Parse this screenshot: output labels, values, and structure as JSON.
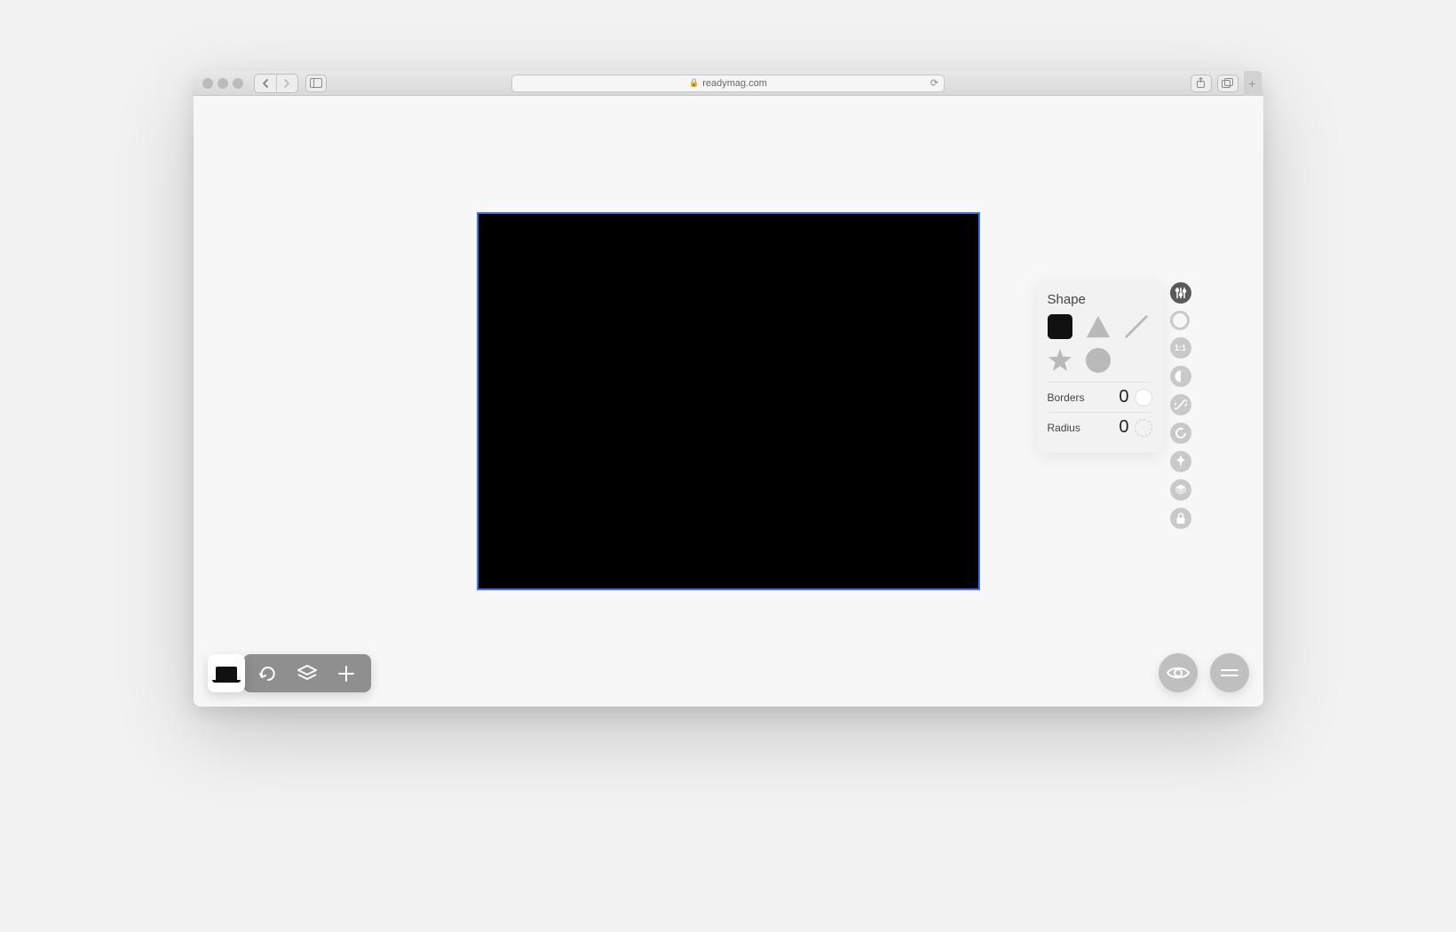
{
  "browser": {
    "url": "readymag.com"
  },
  "shape_panel": {
    "title": "Shape",
    "shapes": {
      "rectangle": "rectangle",
      "triangle": "triangle",
      "line": "line",
      "star": "star",
      "circle": "circle"
    },
    "selected_shape": "rectangle",
    "borders_label": "Borders",
    "borders_value": "0",
    "radius_label": "Radius",
    "radius_value": "0"
  },
  "side_tools": {
    "settings": "settings",
    "fill": "fill",
    "aspect": "1:1",
    "opacity": "opacity",
    "link": "link",
    "rotate": "rotate",
    "pin": "pin",
    "layers": "layers",
    "lock": "lock"
  },
  "bottom_left": {
    "device": "desktop",
    "actions": {
      "undo": "undo",
      "layers": "layers",
      "add": "add"
    }
  },
  "bottom_right": {
    "preview": "preview",
    "menu": "menu"
  },
  "canvas": {
    "shape_fill": "#000000",
    "selection_color": "#3a74ff"
  }
}
